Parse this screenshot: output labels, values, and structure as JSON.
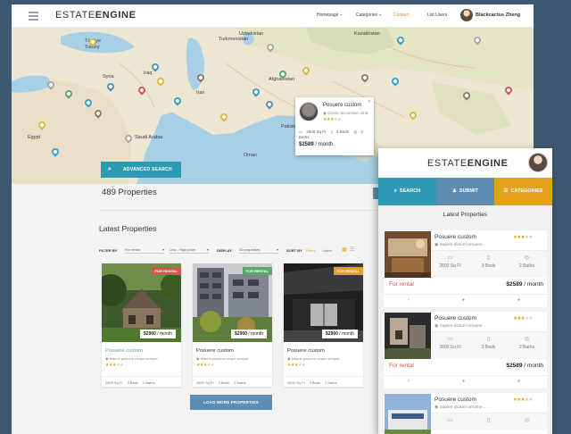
{
  "header": {
    "logo_light": "ESTATE",
    "logo_bold": "ENGINE",
    "nav": [
      {
        "label": "Homepage",
        "dropdown": true
      },
      {
        "label": "Categories",
        "dropdown": true
      },
      {
        "label": "Contact",
        "dropdown": false,
        "active": true
      },
      {
        "label": "List Users",
        "dropdown": false
      }
    ],
    "user_name": "Blackcactus Zheng",
    "accent_color": "#e08a3c"
  },
  "map": {
    "places": [
      "Türkiye",
      "Turkey",
      "Syria",
      "Iraq",
      "Iran",
      "Afghanistan",
      "Turkmenistan",
      "Uzbekistan",
      "Pakistan",
      "Saudi Arabia",
      "Oman",
      "Egypt",
      "Kazakhstan"
    ],
    "popup": {
      "title": "Posuere custom",
      "address": "Donec accumsan urna",
      "sqft": "2800 Sq Ft",
      "beds": "2 Beds",
      "baths": "2 Baths",
      "price": "$2589",
      "period": "month",
      "rating": 3
    },
    "advanced_search_label": "ADVANCED SEARCH"
  },
  "listing": {
    "count_label": "489 Properties",
    "section_title": "Latest Properties",
    "filter_by_label": "FILTER BY",
    "filter_type": "For rental",
    "filter_price": "Low - High price",
    "display_label": "DISPLAY",
    "display_value": "10 properties",
    "sort_label": "SORT BY",
    "sort_options": [
      "Rates",
      "Latest"
    ],
    "cards": [
      {
        "tag": "FOR RENTAL",
        "tag_color": "#d9534f",
        "price": "$2900",
        "period": "month",
        "title": "Posuere custom",
        "address": "Mauris posuere neque semper",
        "rating": 3,
        "sqft": "2800 Sq Ft",
        "beds": "3 Beds",
        "baths": "2 Baths"
      },
      {
        "tag": "FOR RENTAL",
        "tag_color": "#5aa86a",
        "price": "$2900",
        "period": "month",
        "title": "Posuere custom",
        "address": "Mauris posuere neque semper",
        "rating": 3,
        "sqft": "2800 Sq Ft",
        "beds": "3 Beds",
        "baths": "2 Baths"
      },
      {
        "tag": "FOR RENTAL",
        "tag_color": "#e3a21a",
        "price": "$2900",
        "period": "month",
        "title": "Posuere custom",
        "address": "Mauris posuere neque semper",
        "rating": 3,
        "sqft": "2800 Sq Ft",
        "beds": "3 Beds",
        "baths": "2 Baths"
      }
    ],
    "load_more_label": "LOAD MORE PROPERTIES"
  },
  "mobile": {
    "tabs": [
      {
        "label": "SEARCH",
        "color": "#2d9ab3"
      },
      {
        "label": "SUBMIT",
        "color": "#5d8db3"
      },
      {
        "label": "CATEGORIES",
        "color": "#e3a21a"
      }
    ],
    "section_title": "Latest Properties",
    "cards": [
      {
        "title": "Posuere custom",
        "address": "Sapien dictum urname...",
        "rating": 3,
        "sqft": "2800 Sq Ft",
        "beds": "3 Beds",
        "baths": "2 Baths",
        "status": "For rental",
        "price": "$2589",
        "period": "month"
      },
      {
        "title": "Posuere custom",
        "address": "Sapien dictum urname...",
        "rating": 3,
        "sqft": "2800 Sq Ft",
        "beds": "3 Beds",
        "baths": "2 Baths",
        "status": "For rental",
        "price": "$2589",
        "period": "month"
      },
      {
        "title": "Posuere custom",
        "address": "Sapien dictum urname...",
        "rating": 3
      }
    ]
  }
}
